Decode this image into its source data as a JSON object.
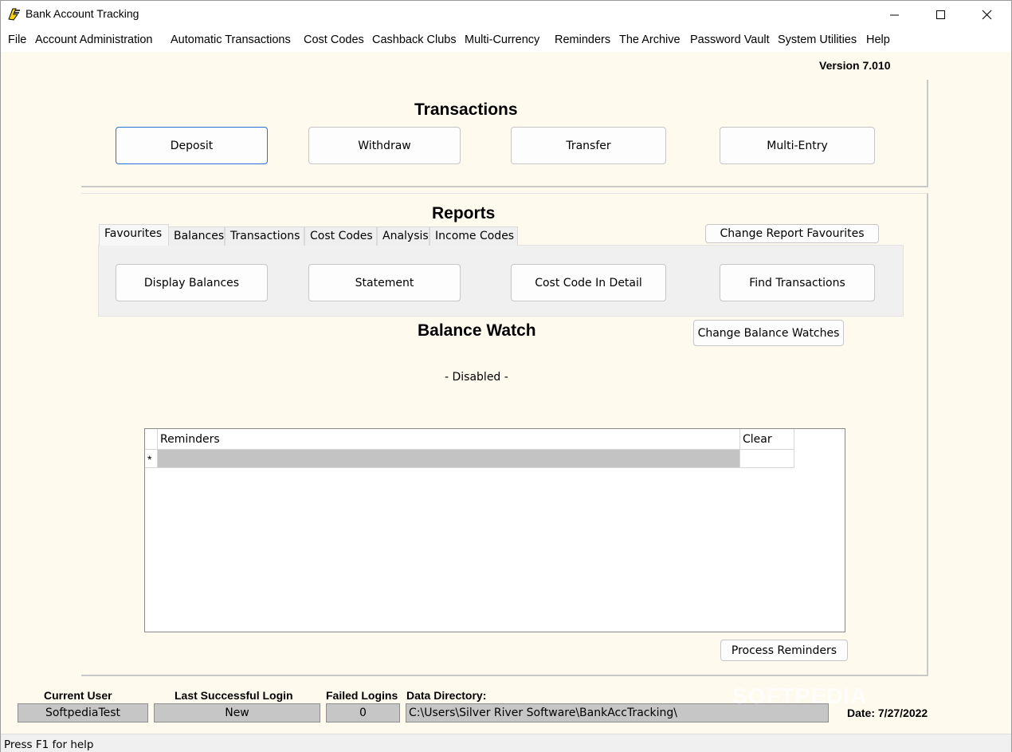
{
  "window": {
    "title": "Bank Account Tracking",
    "version": "Version 7.010"
  },
  "icons": {
    "app": "bank-tracking-app-icon",
    "minimize": "minimize-icon",
    "maximize": "maximize-icon",
    "close": "close-icon"
  },
  "menu": [
    "File",
    "Account Administration",
    "Automatic Transactions",
    "Cost Codes",
    "Cashback Clubs",
    "Multi-Currency",
    "Reminders",
    "The Archive",
    "Password Vault",
    "System Utilities",
    "Help"
  ],
  "transactions": {
    "title": "Transactions",
    "buttons": [
      "Deposit",
      "Withdraw",
      "Transfer",
      "Multi-Entry"
    ]
  },
  "reports": {
    "title": "Reports",
    "tabs": [
      "Favourites",
      "Balances",
      "Transactions",
      "Cost Codes",
      "Analysis",
      "Income Codes"
    ],
    "active_tab": "Favourites",
    "change_favourites": "Change Report Favourites",
    "buttons": [
      "Display Balances",
      "Statement",
      "Cost Code In Detail",
      "Find Transactions"
    ]
  },
  "balance_watch": {
    "title": "Balance Watch",
    "change_button": "Change Balance Watches",
    "status": "- Disabled -"
  },
  "reminders_grid": {
    "columns": [
      "Reminders",
      "Clear"
    ],
    "new_row_marker": "*",
    "process_button": "Process Reminders"
  },
  "status": {
    "current_user_label": "Current User",
    "current_user": "SoftpediaTest",
    "last_login_label": "Last Successful Login",
    "last_login": "New",
    "failed_logins_label": "Failed Logins",
    "failed_logins": "0",
    "data_dir_label": "Data Directory:",
    "data_dir": "C:\\Users\\Silver River Software\\BankAccTracking\\",
    "date": "Date: 7/27/2022",
    "watermark": "SOFTPEDIA"
  },
  "statusbar": {
    "help": "Press F1 for help"
  },
  "colors": {
    "background": "#fffaee",
    "accent": "#2a6fd6",
    "field": "#c6c6c6"
  }
}
